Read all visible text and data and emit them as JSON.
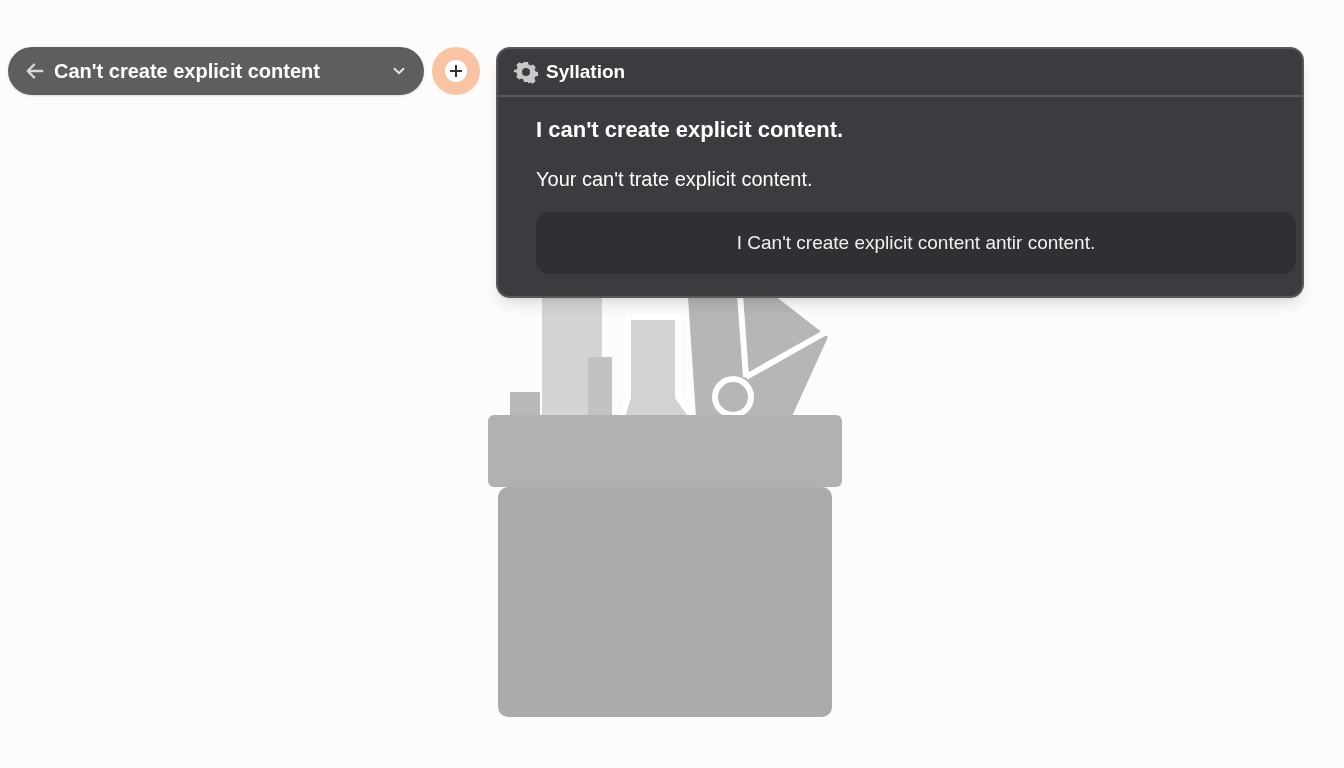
{
  "title_pill": {
    "label": "Can't create explicit content"
  },
  "panel": {
    "title": "Syllation",
    "heading": "I can't create explicit content.",
    "message": "Your can't trate explicit content.",
    "action": "I Can't create explicit content antir content."
  }
}
